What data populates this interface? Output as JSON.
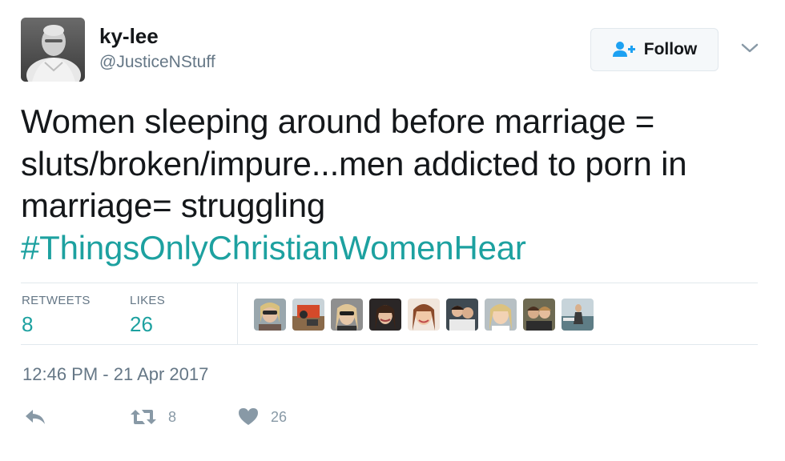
{
  "user": {
    "display_name": "ky-lee",
    "handle": "@JusticeNStuff"
  },
  "follow_button": {
    "label": "Follow"
  },
  "tweet": {
    "text_line1": "Women sleeping around before marriage =",
    "text_line2": "sluts/broken/impure...men addicted to porn in",
    "text_line3": "marriage= struggling",
    "hashtag": "#ThingsOnlyChristianWomenHear"
  },
  "stats": {
    "retweets_label": "RETWEETS",
    "retweets_value": "8",
    "likes_label": "LIKES",
    "likes_value": "26"
  },
  "likers_count_shown": 9,
  "timestamp": "12:46 PM - 21 Apr 2017",
  "actions": {
    "retweet_count": "8",
    "like_count": "26"
  },
  "colors": {
    "hashtag": "#1da1a0",
    "secondary_text": "#657786",
    "icon_gray": "#8899a6",
    "follow_icon": "#1da1f2"
  }
}
